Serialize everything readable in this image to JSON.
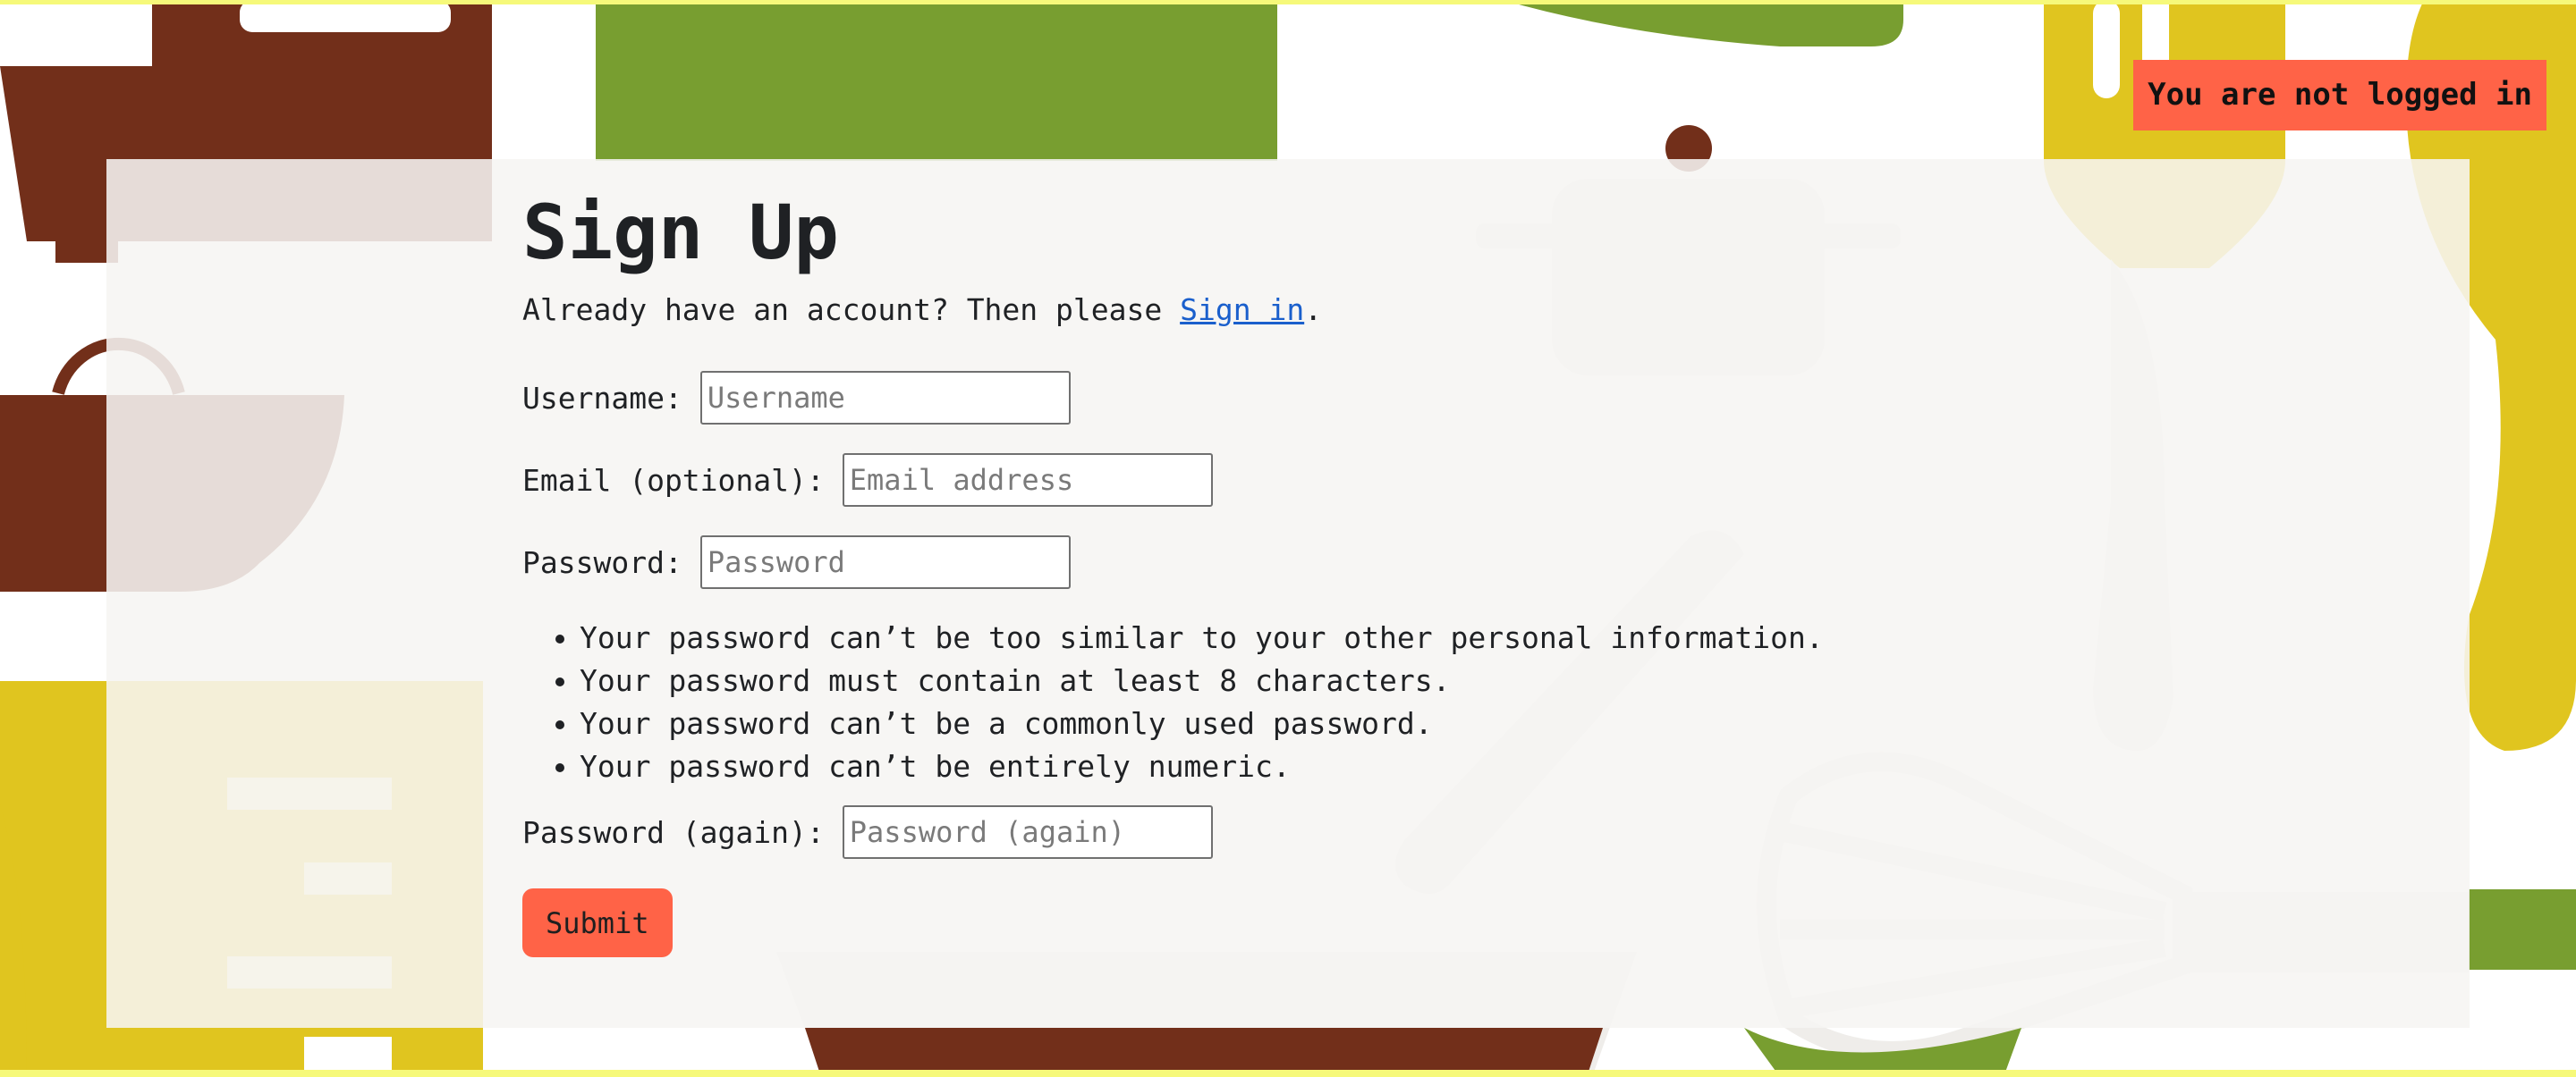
{
  "status": {
    "text": "You are not logged in",
    "color": "#ff6347"
  },
  "page": {
    "title": "Sign Up",
    "signin_prefix": "Already have an account? Then please ",
    "signin_link": "Sign in",
    "signin_suffix": "."
  },
  "form": {
    "username": {
      "label": "Username:",
      "placeholder": "Username",
      "value": ""
    },
    "email": {
      "label": "Email (optional):",
      "placeholder": "Email address",
      "value": ""
    },
    "password": {
      "label": "Password:",
      "placeholder": "Password",
      "value": ""
    },
    "password_rules": [
      "Your password can’t be too similar to your other personal information.",
      "Your password must contain at least 8 characters.",
      "Your password can’t be a commonly used password.",
      "Your password can’t be entirely numeric."
    ],
    "password_again": {
      "label": "Password (again):",
      "placeholder": "Password (again)",
      "value": ""
    },
    "submit_label": "Submit"
  },
  "theme": {
    "accent": "#ff6347",
    "link": "#1a5fcc",
    "brown": "#722f1a",
    "green": "#789e30",
    "yellow": "#e0c51f",
    "border_yellow": "#f6f97a"
  },
  "decor_icons": [
    "mixer-icon",
    "pot-icon",
    "fork-icon",
    "spoon-icon",
    "whisk-icon",
    "rolling-pin-icon",
    "bowl-icon",
    "spatula-icon",
    "grater-icon"
  ]
}
